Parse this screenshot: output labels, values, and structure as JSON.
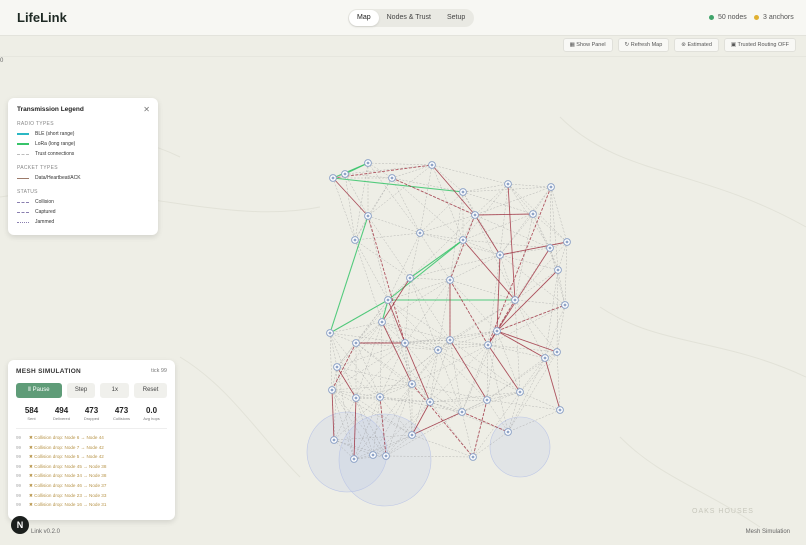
{
  "app": {
    "title": "LifeLink",
    "version": "Link v0.2.0",
    "footer_right": "Mesh Simulation",
    "avatar_letter": "N",
    "edge_mark": "0"
  },
  "nav": {
    "tabs": [
      "Map",
      "Nodes & Trust",
      "Setup"
    ],
    "active": "Map"
  },
  "stats": {
    "nodes": "50 nodes",
    "anchors": "3 anchors",
    "nodes_color": "#3fa46a",
    "anchors_color": "#e0b030"
  },
  "toolbar": {
    "show_panel": "Show Panel",
    "refresh_map": "Refresh Map",
    "estimated": "Estimated",
    "trusted_routing": "Trusted Routing OFF"
  },
  "legend": {
    "title": "Transmission Legend",
    "radio_types_heading": "RADIO TYPES",
    "radio_types": [
      {
        "label": "BLE (short range)",
        "color": "#2bb8c4"
      },
      {
        "label": "LoRa (long range)",
        "color": "#37c46a"
      },
      {
        "label": "Trust connections",
        "color": "#c8c8c8"
      }
    ],
    "packet_types_heading": "PACKET TYPES",
    "packet_types": [
      {
        "label": "Data/Heartbeat/ACK",
        "color": "#9c7a6a"
      }
    ],
    "status_heading": "STATUS",
    "statuses": [
      {
        "label": "Collision",
        "color": "#8a7fb0"
      },
      {
        "label": "Captured",
        "color": "#8a7fb0"
      },
      {
        "label": "Jammed",
        "color": "#8a7fb0"
      }
    ]
  },
  "simulation": {
    "title": "MESH SIMULATION",
    "tick": "tick 99",
    "buttons": {
      "pause": "Ⅱ Pause",
      "step": "Step",
      "speed": "1x",
      "reset": "Reset"
    },
    "counters": [
      {
        "value": "584",
        "label": "Sent"
      },
      {
        "value": "494",
        "label": "Delivered"
      },
      {
        "value": "473",
        "label": "Dropped"
      },
      {
        "value": "473",
        "label": "Collisions"
      },
      {
        "value": "0.0",
        "label": "Avg hops"
      }
    ],
    "log": [
      {
        "t": "99",
        "text": "✖ Collision drop: Node 6 → Node 44"
      },
      {
        "t": "99",
        "text": "✖ Collision drop: Node 7 → Node 42"
      },
      {
        "t": "99",
        "text": "✖ Collision drop: Node 5 → Node 42"
      },
      {
        "t": "99",
        "text": "✖ Collision drop: Node 45 → Node 38"
      },
      {
        "t": "99",
        "text": "✖ Collision drop: Node 34 → Node 38"
      },
      {
        "t": "99",
        "text": "✖ Collision drop: Node 46 → Node 37"
      },
      {
        "t": "99",
        "text": "✖ Collision drop: Node 23 → Node 33"
      },
      {
        "t": "99",
        "text": "✖ Collision drop: Node 16 → Node 31"
      }
    ]
  },
  "map": {
    "place_labels": [
      "OAKS HOUSES"
    ],
    "colors": {
      "node": "#8fa4c8",
      "lora": "#37c46a",
      "packet": "#a03040",
      "trust": "#9a9a9a",
      "anchor_range": "#bcc6e6"
    }
  }
}
